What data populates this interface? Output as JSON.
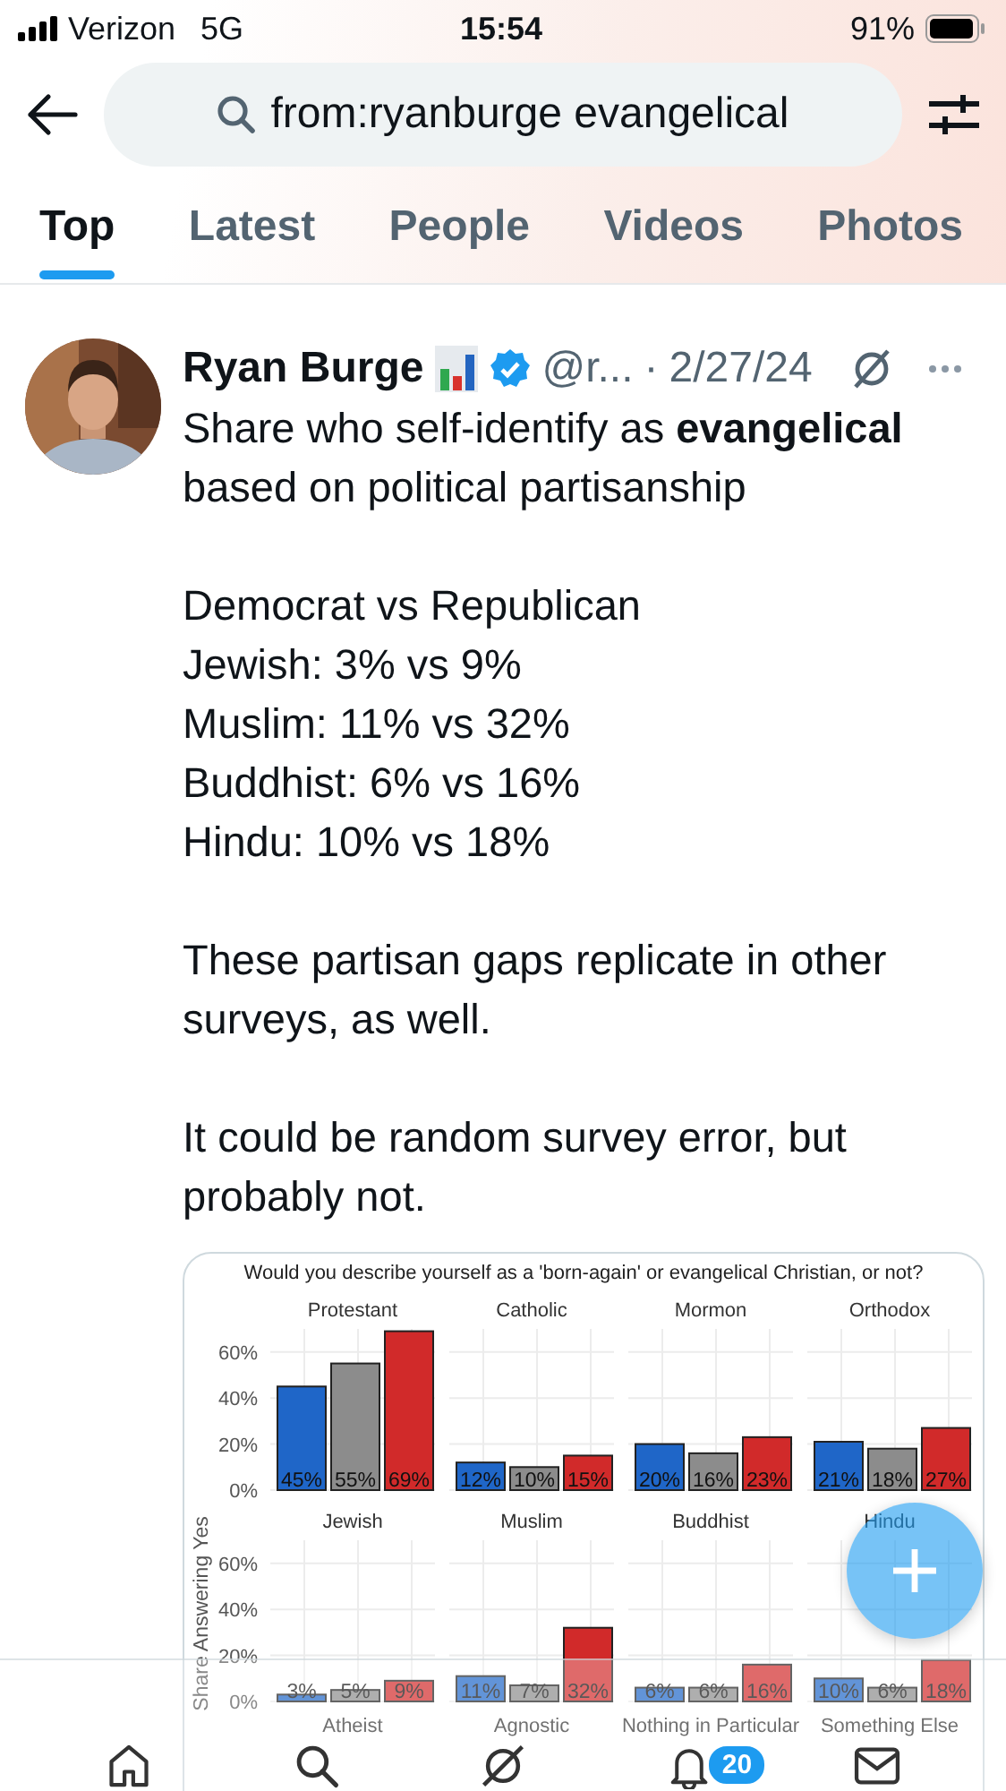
{
  "status_bar": {
    "carrier": "Verizon",
    "network": "5G",
    "time": "15:54",
    "battery": "91%"
  },
  "search": {
    "value": "from:ryanburge evangelical"
  },
  "tabs": [
    {
      "label": "Top",
      "selected": true
    },
    {
      "label": "Latest",
      "selected": false
    },
    {
      "label": "People",
      "selected": false
    },
    {
      "label": "Videos",
      "selected": false
    },
    {
      "label": "Photos",
      "selected": false
    }
  ],
  "tweet": {
    "author": "Ryan Burge",
    "handle": "@r...",
    "separator": "·",
    "date": "2/27/24",
    "verified": true,
    "paragraphs": [
      [
        "Share who self-identify as **evangelical** based on political partisanship"
      ],
      [
        "Democrat vs Republican",
        "Jewish: 3% vs 9%",
        "Muslim: 11% vs 32%",
        "Buddhist: 6% vs 16%",
        "Hindu: 10% vs 18%"
      ],
      [
        "These partisan gaps replicate in other surveys, as well."
      ],
      [
        "It could be random survey error, but probably not."
      ]
    ],
    "image_title": "Would you describe yourself as a 'born-again' or evangelical Christian, or not?",
    "chart_panels": [
      {
        "chart_data": {
          "type": "bar",
          "stacked": false,
          "grid": true,
          "categories": [
            "Protestant",
            "Catholic",
            "Mormon",
            "Orthodox"
          ],
          "ylim": [
            0,
            70
          ],
          "yticks": [
            {
              "value": 0,
              "label": "0%"
            },
            {
              "value": 20,
              "label": "20%"
            },
            {
              "value": 40,
              "label": "40%"
            },
            {
              "value": 60,
              "label": "60%"
            }
          ],
          "series": [
            {
              "color": "#1f66c8",
              "values": [
                45,
                12,
                20,
                21
              ]
            },
            {
              "color": "#8c8c8c",
              "values": [
                55,
                10,
                16,
                18
              ]
            },
            {
              "color": "#d12a2a",
              "values": [
                69,
                15,
                23,
                27
              ]
            }
          ],
          "value_labels": [
            [
              "45%",
              "12%",
              "20%",
              "21%"
            ],
            [
              "55%",
              "10%",
              "16%",
              "18%"
            ],
            [
              "69%",
              "15%",
              "23%",
              "27%"
            ]
          ]
        }
      },
      {
        "chart_data": {
          "type": "bar",
          "stacked": false,
          "grid": true,
          "ylabel": "Share Answering Yes",
          "categories": [
            "Jewish",
            "Muslim",
            "Buddhist",
            "Hindu"
          ],
          "ylim": [
            0,
            70
          ],
          "yticks": [
            {
              "value": 0,
              "label": "0%"
            },
            {
              "value": 20,
              "label": "20%"
            },
            {
              "value": 40,
              "label": "40%"
            },
            {
              "value": 60,
              "label": "60%"
            }
          ],
          "series": [
            {
              "color": "#1f66c8",
              "values": [
                3,
                11,
                6,
                10
              ]
            },
            {
              "color": "#8c8c8c",
              "values": [
                5,
                7,
                6,
                6
              ]
            },
            {
              "color": "#d12a2a",
              "values": [
                9,
                32,
                16,
                18
              ]
            }
          ],
          "value_labels": [
            [
              "3%",
              "11%",
              "6%",
              "10%"
            ],
            [
              "5%",
              "7%",
              "6%",
              "6%"
            ],
            [
              "9%",
              "32%",
              "16%",
              "18%"
            ]
          ]
        }
      },
      {
        "facet_labels": [
          "Atheist",
          "Agnostic",
          "Nothing in Particular",
          "Something Else"
        ]
      }
    ]
  },
  "nav": {
    "notification_count": "20"
  }
}
